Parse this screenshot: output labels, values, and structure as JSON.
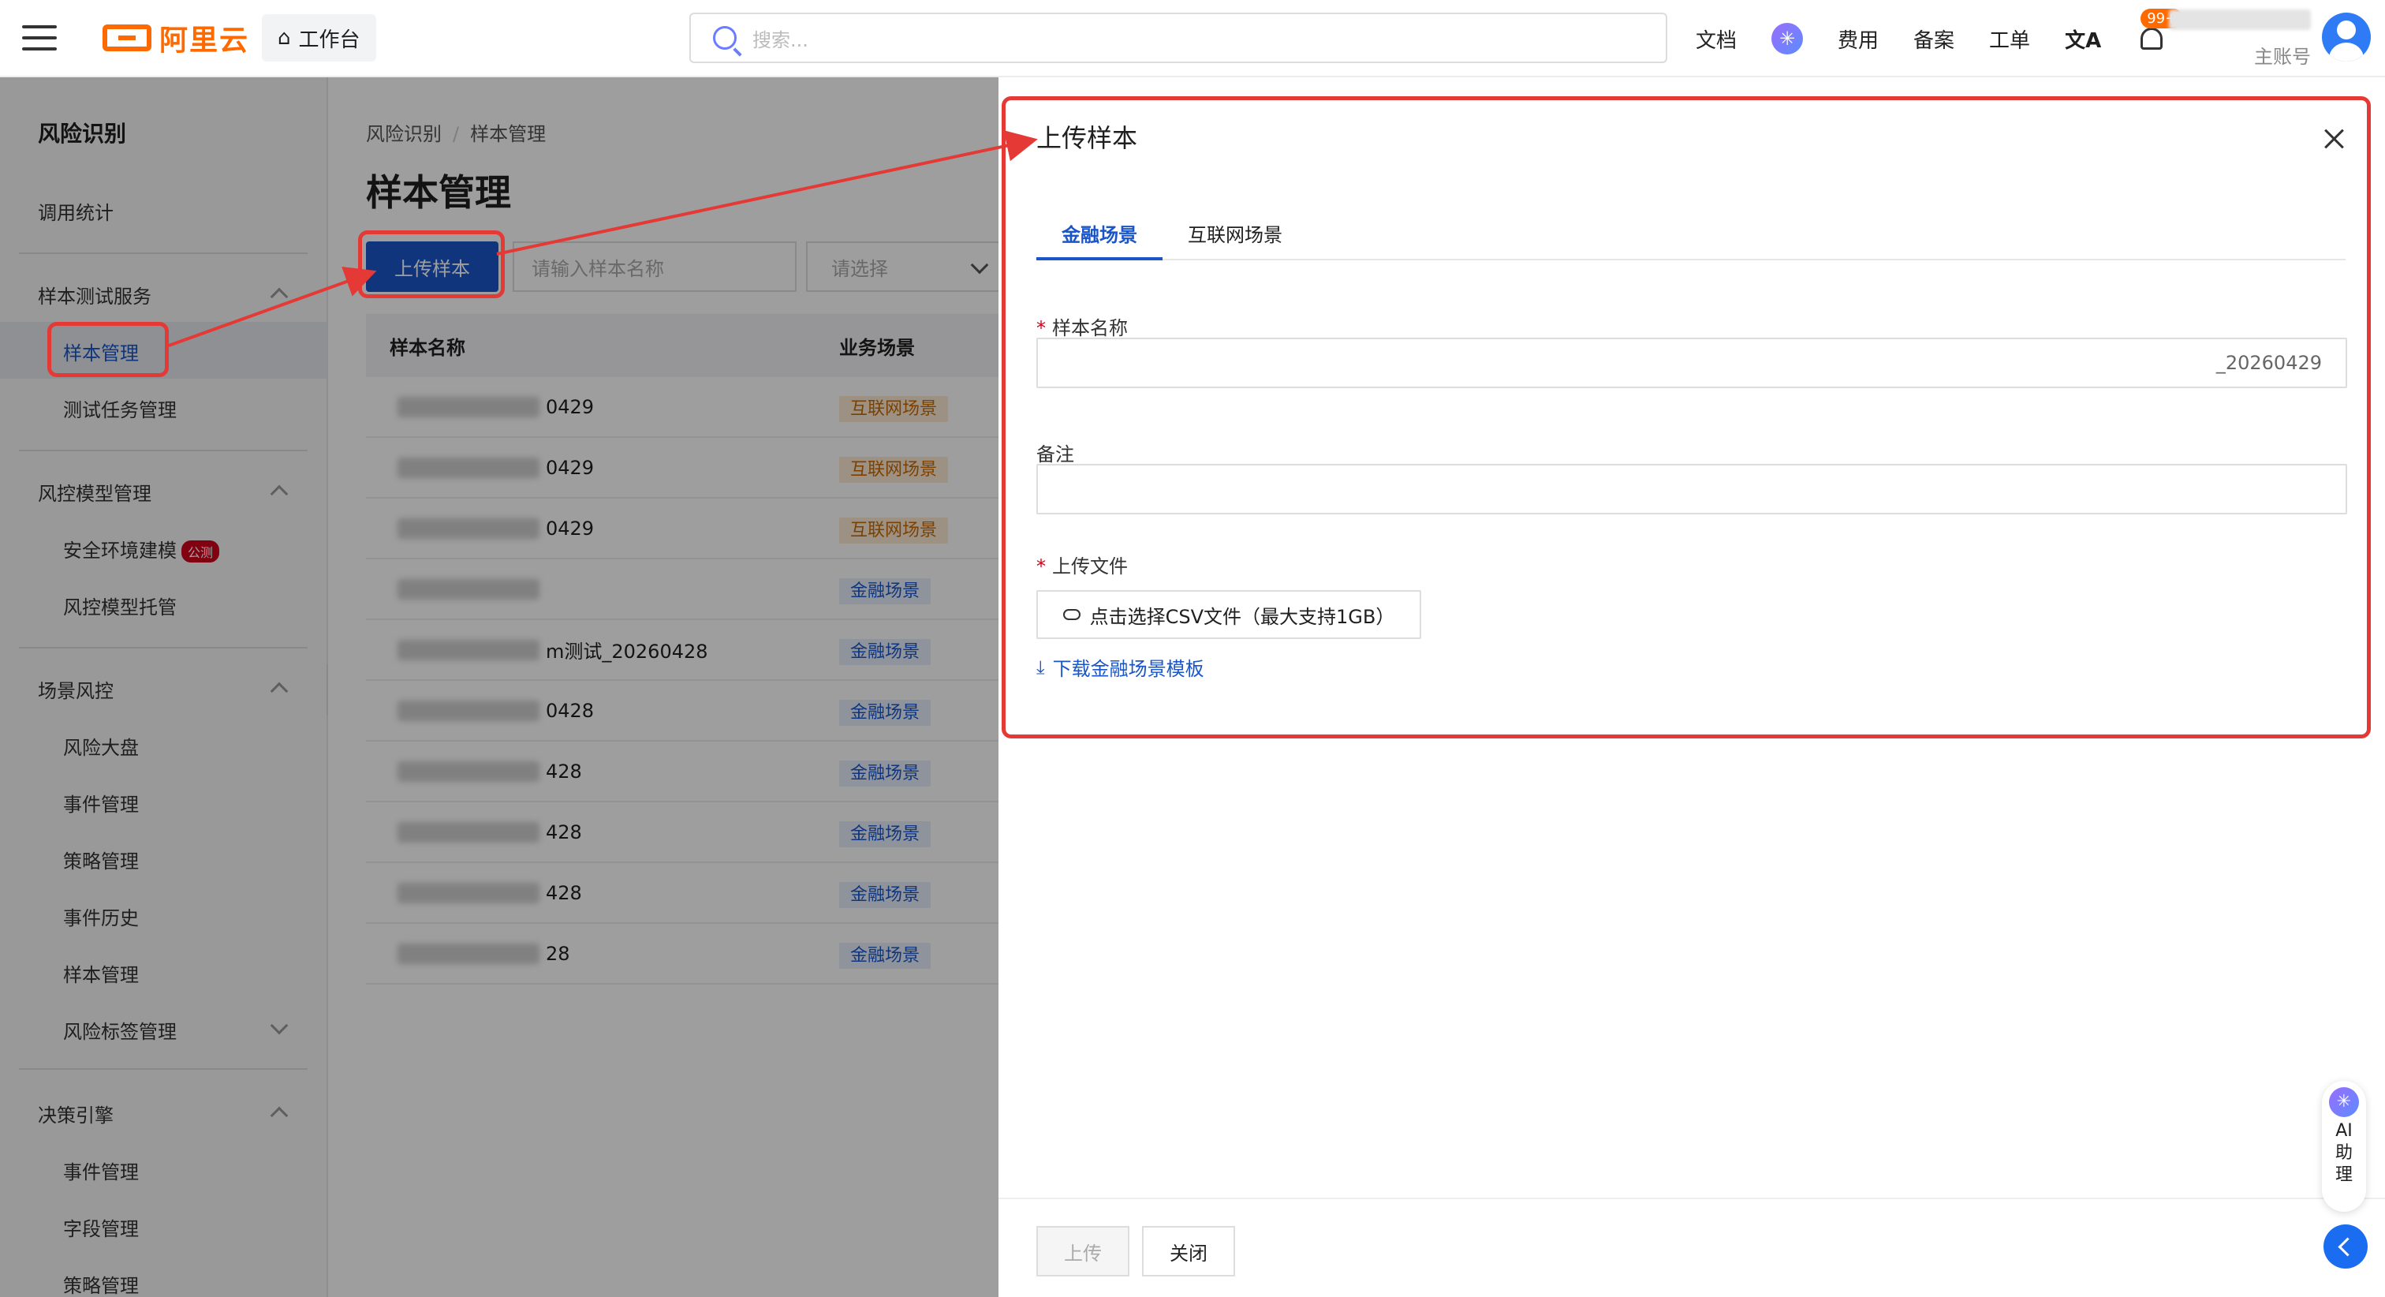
{
  "header": {
    "logo_text": "阿里云",
    "workbench": "工作台",
    "search_placeholder": "搜索...",
    "links": [
      "文档",
      "费用",
      "备案",
      "工单"
    ],
    "notification_badge": "99+",
    "account_sub": "主账号"
  },
  "sidebar": {
    "title": "风险识别",
    "items": {
      "call_stats": "调用统计",
      "group_sample_test": "样本测试服务",
      "sample_mgmt": "样本管理",
      "test_task_mgmt": "测试任务管理",
      "group_model_mgmt": "风控模型管理",
      "safe_env_model": "安全环境建模",
      "safe_env_tag": "公测",
      "model_hosting": "风控模型托管",
      "group_scene_risk": "场景风控",
      "risk_dashboard": "风险大盘",
      "event_mgmt": "事件管理",
      "strategy_mgmt": "策略管理",
      "event_history": "事件历史",
      "sample_mgmt2": "样本管理",
      "risk_tag_mgmt": "风险标签管理",
      "group_decision": "决策引擎",
      "event_mgmt2": "事件管理",
      "field_mgmt": "字段管理",
      "strategy_mgmt2": "策略管理"
    }
  },
  "main": {
    "breadcrumb": [
      "风险识别",
      "样本管理"
    ],
    "title": "样本管理",
    "upload_button": "上传样本",
    "name_placeholder": "请输入样本名称",
    "select_placeholder": "请选择",
    "columns": [
      "样本名称",
      "业务场景"
    ],
    "rows": [
      {
        "name_suffix": "0429",
        "scene": "互联网场景",
        "type": "internet"
      },
      {
        "name_suffix": "0429",
        "scene": "互联网场景",
        "type": "internet"
      },
      {
        "name_suffix": "0429",
        "scene": "互联网场景",
        "type": "internet"
      },
      {
        "name_suffix": "",
        "scene": "金融场景",
        "type": "finance"
      },
      {
        "name_suffix": "m测试_20260428",
        "scene": "金融场景",
        "type": "finance"
      },
      {
        "name_suffix": "0428",
        "scene": "金融场景",
        "type": "finance"
      },
      {
        "name_suffix": "428",
        "scene": "金融场景",
        "type": "finance"
      },
      {
        "name_suffix": "428",
        "scene": "金融场景",
        "type": "finance"
      },
      {
        "name_suffix": "428",
        "scene": "金融场景",
        "type": "finance"
      },
      {
        "name_suffix": "28",
        "scene": "金融场景",
        "type": "finance"
      }
    ]
  },
  "drawer": {
    "title": "上传样本",
    "tabs": [
      "金融场景",
      "互联网场景"
    ],
    "sample_name_label": "样本名称",
    "sample_name_value": "_20260429",
    "remark_label": "备注",
    "remark_value": "",
    "upload_file_label": "上传文件",
    "file_button": "点击选择CSV文件（最大支持1GB）",
    "download_link": "下载金融场景模板",
    "footer_upload": "上传",
    "footer_close": "关闭"
  },
  "assistant": {
    "label_lines": [
      "AI",
      "助",
      "理"
    ]
  },
  "colors": {
    "brand": "#ff6a00",
    "primary": "#1a56c8",
    "annotation": "#e53935"
  }
}
